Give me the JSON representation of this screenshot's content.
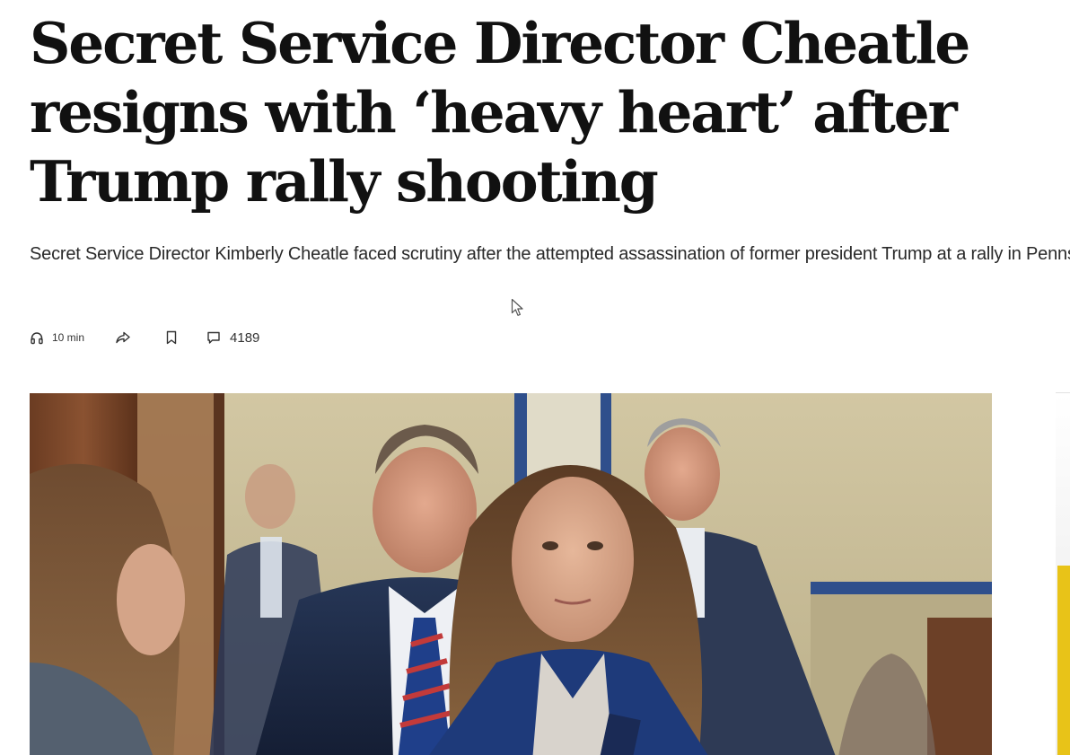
{
  "article": {
    "headline": "Secret Service Director Cheatle resigns with ‘heavy heart’ after Trump rally shooting",
    "dek": "Secret Service Director Kimberly Cheatle faced scrutiny after the attempted assassination of former president Trump at a rally in Pennsylvania."
  },
  "meta": {
    "listen_label": "10 min",
    "comments_count": "4189",
    "icons": {
      "listen": "headphones-icon",
      "share": "share-arrow-icon",
      "save": "bookmark-icon",
      "comments": "comment-bubble-icon"
    }
  },
  "colors": {
    "text": "#111111",
    "dek_text": "#2a2a2a",
    "sidebar_accent": "#e8c318"
  }
}
